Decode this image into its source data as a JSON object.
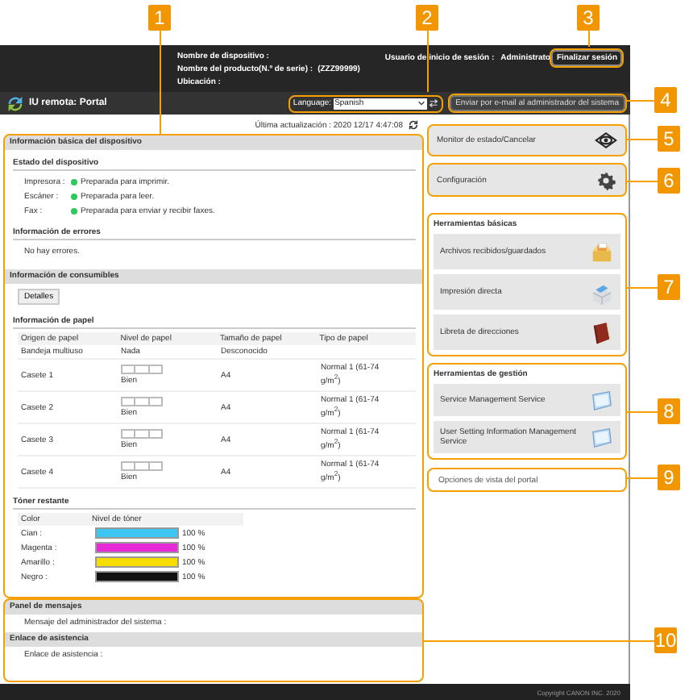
{
  "callouts": [
    "1",
    "2",
    "3",
    "4",
    "5",
    "6",
    "7",
    "8",
    "9",
    "10"
  ],
  "header": {
    "device_name_label": "Nombre de dispositivo :",
    "product_label": "Nombre del producto(N.º de serie) :",
    "product_value": "(ZZZ99999)",
    "location_label": "Ubicación :",
    "login_user_label": "Usuario de inicio de sesión :",
    "login_user": "Administrato",
    "logout_button": "Finalizar sesión"
  },
  "title": "IU remota: Portal",
  "language": {
    "label": "Language:",
    "value": "Spanish"
  },
  "email_button": "Enviar por e-mail al administrador del sistema",
  "last_update": "Última actualización : 2020 12/17 4:47:08",
  "device_info": {
    "title": "Información básica del dispositivo",
    "status_title": "Estado del dispositivo",
    "statuses": [
      {
        "device": "Impresora :",
        "text": "Preparada para imprimir."
      },
      {
        "device": "Escáner :",
        "text": "Preparada para leer."
      },
      {
        "device": "Fax :",
        "text": "Preparada para enviar y recibir faxes."
      }
    ],
    "errors_title": "Información de errores",
    "errors_text": "No hay errores."
  },
  "consumables": {
    "title": "Información de consumibles",
    "details_button": "Detalles",
    "paper_title": "Información de papel",
    "paper_columns": [
      "Origen de papel",
      "Nivel de papel",
      "Tamaño de papel",
      "Tipo de papel"
    ],
    "paper_rows": [
      {
        "kind": "text",
        "source": "Bandeja multiuso",
        "level": "Nada",
        "size": "Desconocido"
      },
      {
        "kind": "gauge",
        "source": "Casete 1",
        "level": "Bien",
        "size": "A4",
        "type": "Normal 1 (61-74 g/m$^{2}$)"
      },
      {
        "kind": "gauge",
        "source": "Casete 2",
        "level": "Bien",
        "size": "A4",
        "type": "Normal 1 (61-74 g/m$^{2}$)"
      },
      {
        "kind": "gauge",
        "source": "Casete 3",
        "level": "Bien",
        "size": "A4",
        "type": "Normal 1 (61-74 g/m$^{2}$)"
      },
      {
        "kind": "gauge",
        "source": "Casete 4",
        "level": "Bien",
        "size": "A4",
        "type": "Normal 1 (61-74 g/m$^{2}$)"
      }
    ],
    "toner_title": "Tóner restante",
    "toner_columns": [
      "Color",
      "Nivel de tóner"
    ],
    "toner_rows": [
      {
        "name": "Cian :",
        "color": "#3ec6f2",
        "level": 1,
        "reading": "100 %"
      },
      {
        "name": "Magenta :",
        "color": "#e62ad6",
        "level": 1,
        "reading": "100 %"
      },
      {
        "name": "Amarillo :",
        "color": "#f7dc00",
        "level": 1,
        "reading": "100 %"
      },
      {
        "name": "Negro :",
        "color": "#111111",
        "level": 1,
        "reading": "100 %"
      }
    ]
  },
  "messages": {
    "title": "Panel de mensajes",
    "text": "Mensaje del administrador del sistema :"
  },
  "support": {
    "title": "Enlace de asistencia",
    "text": "Enlace de asistencia :"
  },
  "side": {
    "top_buttons": [
      {
        "label": "Monitor de estado/Cancelar"
      },
      {
        "label": "Configuración"
      }
    ],
    "groups": [
      {
        "title": "Herramientas básicas",
        "items": [
          {
            "label": "Archivos recibidos/guardados"
          },
          {
            "label": "Impresión directa"
          },
          {
            "label": "Libreta de direcciones"
          }
        ]
      },
      {
        "title": "Herramientas de gestión",
        "items": [
          {
            "label": "Service Management Service"
          },
          {
            "label": "User Setting Information Management Service"
          }
        ]
      }
    ],
    "view_options": "Opciones de vista del portal"
  },
  "footer": "Copyright CANON INC. 2020"
}
